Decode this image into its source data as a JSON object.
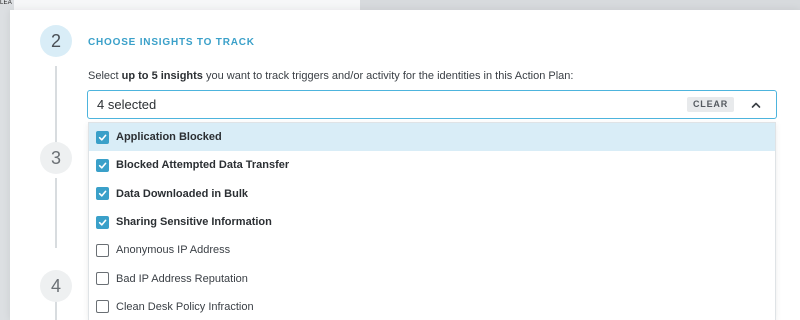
{
  "background": {
    "tag_text": "LEA"
  },
  "steps": [
    {
      "number": "2",
      "active": true
    },
    {
      "number": "3",
      "active": false
    },
    {
      "number": "4",
      "active": false
    }
  ],
  "section": {
    "title": "CHOOSE INSIGHTS TO TRACK",
    "instructions_prefix": "Select ",
    "instructions_bold": "up to 5 insights",
    "instructions_suffix": " you want to track triggers and/or activity for the identities in this Action Plan:"
  },
  "select": {
    "value": "4 selected",
    "clear_label": "CLEAR",
    "expanded": true
  },
  "options": [
    {
      "label": "Application Blocked",
      "checked": true,
      "highlighted": true
    },
    {
      "label": "Blocked Attempted Data Transfer",
      "checked": true,
      "highlighted": false
    },
    {
      "label": "Data Downloaded in Bulk",
      "checked": true,
      "highlighted": false
    },
    {
      "label": "Sharing Sensitive Information",
      "checked": true,
      "highlighted": false
    },
    {
      "label": "Anonymous IP Address",
      "checked": false,
      "highlighted": false
    },
    {
      "label": "Bad IP Address Reputation",
      "checked": false,
      "highlighted": false
    },
    {
      "label": "Clean Desk Policy Infraction",
      "checked": false,
      "highlighted": false
    }
  ],
  "colors": {
    "accent": "#3aa0c9",
    "highlight": "#d9edf7",
    "border_focus": "#4db4dd"
  },
  "icons": {
    "chevron": "chevron-up-icon",
    "checkbox_checked": "checkmark-icon"
  }
}
